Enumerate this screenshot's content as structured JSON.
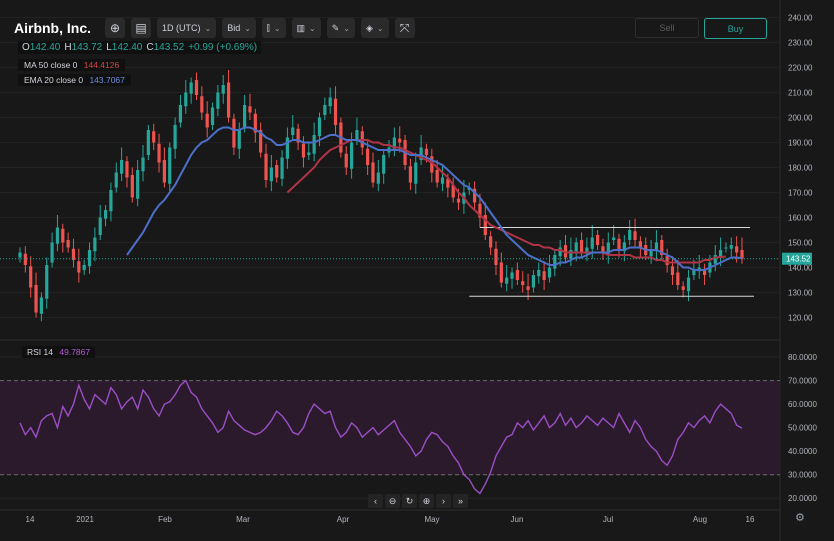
{
  "toolbar": {
    "symbol": "Airbnb, Inc.",
    "interval": "1D (UTC)",
    "price_source": "Bid",
    "buttons": [
      "plus-circle-icon",
      "keyboard-icon",
      "candles-icon",
      "indicators-icon",
      "drawing-icon",
      "layers-icon",
      "fullscreen-icon"
    ]
  },
  "ohlc": {
    "o_label": "O",
    "o": "142.40",
    "h_label": "H",
    "h": "143.72",
    "l_label": "L",
    "l": "142.40",
    "c_label": "C",
    "c": "143.52",
    "change": "+0.99 (+0.69%)"
  },
  "indicators": [
    {
      "name": "MA 50 close 0",
      "value": "144.4126",
      "color": "#d2464f"
    },
    {
      "name": "EMA 20 close 0",
      "value": "143.7067",
      "color": "#5b7bd6"
    }
  ],
  "trade": {
    "sell": "Sell",
    "buy": "Buy"
  },
  "rsi": {
    "name": "RSI 14",
    "value": "49.7867",
    "color": "#a64cc9"
  },
  "price_axis": {
    "labels": [
      "240.00",
      "230.00",
      "220.00",
      "210.00",
      "200.00",
      "190.00",
      "180.00",
      "170.00",
      "160.00",
      "150.00",
      "140.00",
      "130.00",
      "120.00"
    ],
    "last_price": "143.52"
  },
  "rsi_axis": {
    "labels": [
      "80.0000",
      "70.0000",
      "60.0000",
      "50.0000",
      "40.0000",
      "30.0000",
      "20.0000"
    ]
  },
  "time_axis": {
    "labels": [
      "14",
      "2021",
      "Feb",
      "Mar",
      "Apr",
      "May",
      "Jun",
      "Jul",
      "Aug",
      "16"
    ]
  },
  "colors": {
    "up": "#26a69a",
    "down": "#ef5350",
    "ma": "#b03446",
    "ema": "#4c6fc9",
    "rsi": "#9b4fc4",
    "rsi_band": "#2a1a2c",
    "bg": "#181818"
  },
  "chart_data": {
    "type": "candlestick",
    "title": "Airbnb, Inc.",
    "ylim": [
      115,
      243
    ],
    "rsi_ylim": [
      15,
      83
    ],
    "closes": [
      146,
      141,
      132,
      122,
      128,
      141,
      150,
      156,
      150,
      148,
      143,
      138,
      141,
      147,
      152,
      160,
      163,
      171,
      178,
      183,
      176,
      168,
      179,
      184,
      195,
      190,
      182,
      174,
      188,
      197,
      205,
      210,
      214,
      209,
      202,
      196,
      204,
      210,
      213,
      200,
      188,
      195,
      205,
      202,
      194,
      186,
      175,
      180,
      176,
      184,
      192,
      196,
      190,
      184,
      186,
      193,
      200,
      205,
      208,
      197,
      186,
      180,
      190,
      195,
      188,
      181,
      174,
      178,
      185,
      188,
      192,
      190,
      181,
      174,
      182,
      188,
      185,
      178,
      174,
      176,
      172,
      168,
      166,
      170,
      172,
      166,
      160,
      153,
      148,
      141,
      134,
      136,
      138,
      135,
      133,
      131,
      137,
      139,
      135,
      140,
      145,
      148,
      144,
      147,
      150,
      146,
      148,
      152,
      149,
      146,
      150,
      152,
      147,
      150,
      155,
      151,
      148,
      145,
      147,
      150,
      145,
      141,
      137,
      133,
      131,
      136,
      139,
      140,
      137,
      142,
      145,
      147,
      148,
      149,
      146,
      143.5
    ],
    "ma50": [
      null,
      null,
      null,
      null,
      null,
      null,
      null,
      null,
      null,
      null,
      null,
      null,
      null,
      null,
      null,
      null,
      null,
      null,
      null,
      null,
      null,
      null,
      null,
      null,
      null,
      null,
      null,
      null,
      null,
      null,
      null,
      null,
      null,
      null,
      null,
      null,
      null,
      null,
      null,
      null,
      null,
      null,
      null,
      null,
      null,
      null,
      null,
      null,
      null,
      null,
      170,
      172,
      174,
      176,
      178,
      180,
      183,
      185,
      187,
      188,
      189,
      190,
      191,
      191,
      191,
      191,
      190,
      190,
      189,
      189,
      188,
      188,
      187,
      186,
      185,
      184,
      183,
      182,
      180,
      178,
      176,
      173,
      170,
      168,
      165,
      163,
      161,
      159,
      157,
      156,
      155,
      154,
      153,
      152,
      151,
      150,
      149,
      149,
      148,
      148,
      147,
      147,
      146,
      146,
      146,
      146,
      146,
      146,
      146,
      146,
      145,
      145,
      145,
      145,
      145,
      144,
      144,
      144,
      144,
      143,
      143,
      142,
      142,
      142,
      142,
      142,
      142,
      142,
      143,
      143,
      144,
      144.2,
      144.4
    ],
    "ema20": [
      null,
      null,
      null,
      null,
      null,
      null,
      null,
      null,
      null,
      null,
      null,
      null,
      null,
      null,
      null,
      null,
      null,
      null,
      null,
      null,
      145,
      148,
      151,
      154,
      158,
      162,
      165,
      167,
      170,
      173,
      177,
      181,
      185,
      188,
      190,
      191,
      193,
      195,
      196,
      196,
      195,
      195,
      196,
      196,
      195,
      194,
      192,
      191,
      189,
      189,
      190,
      191,
      191,
      190,
      190,
      190,
      191,
      192,
      193,
      193,
      192,
      191,
      191,
      191,
      190,
      189,
      188,
      187,
      187,
      187,
      187,
      187,
      186,
      185,
      185,
      185,
      184,
      183,
      182,
      181,
      179,
      177,
      175,
      173,
      172,
      170,
      168,
      165,
      162,
      159,
      156,
      153,
      151,
      149,
      147,
      145,
      144,
      143,
      142,
      141,
      141,
      142,
      142,
      143,
      144,
      144,
      145,
      146,
      146,
      146,
      146,
      147,
      147,
      147,
      148,
      148,
      148,
      147,
      147,
      147,
      146,
      145,
      144,
      142,
      140,
      140,
      139,
      139,
      139,
      140,
      141,
      142,
      143,
      144,
      144,
      143.7
    ],
    "rsi": [
      52,
      47,
      50,
      46,
      53,
      55,
      56,
      50,
      59,
      55,
      60,
      68,
      62,
      58,
      64,
      62,
      60,
      67,
      64,
      58,
      61,
      63,
      58,
      66,
      63,
      58,
      55,
      60,
      61,
      64,
      68,
      70,
      65,
      63,
      58,
      55,
      52,
      48,
      50,
      57,
      53,
      51,
      49,
      48,
      47,
      48,
      50,
      53,
      57,
      55,
      52,
      48,
      47,
      50,
      56,
      60,
      58,
      56,
      57,
      50,
      46,
      48,
      52,
      50,
      46,
      48,
      50,
      47,
      49,
      51,
      53,
      48,
      45,
      42,
      38,
      40,
      45,
      48,
      47,
      44,
      42,
      38,
      35,
      30,
      28,
      24,
      22,
      26,
      31,
      38,
      42,
      46,
      47,
      52,
      50,
      53,
      49,
      52,
      55,
      50,
      52,
      56,
      51,
      54,
      50,
      52,
      55,
      53,
      51,
      54,
      52,
      50,
      56,
      52,
      48,
      53,
      50,
      45,
      42,
      40,
      36,
      34,
      38,
      45,
      48,
      52,
      50,
      53,
      55,
      52,
      57,
      60,
      58,
      56,
      51,
      49.8
    ],
    "support_line": 128.5,
    "resistance_line": 156,
    "rsi_levels": [
      30,
      70
    ],
    "x_categories": [
      "14",
      "2021",
      "Feb",
      "Mar",
      "Apr",
      "May",
      "Jun",
      "Jul",
      "Aug",
      "16"
    ]
  }
}
